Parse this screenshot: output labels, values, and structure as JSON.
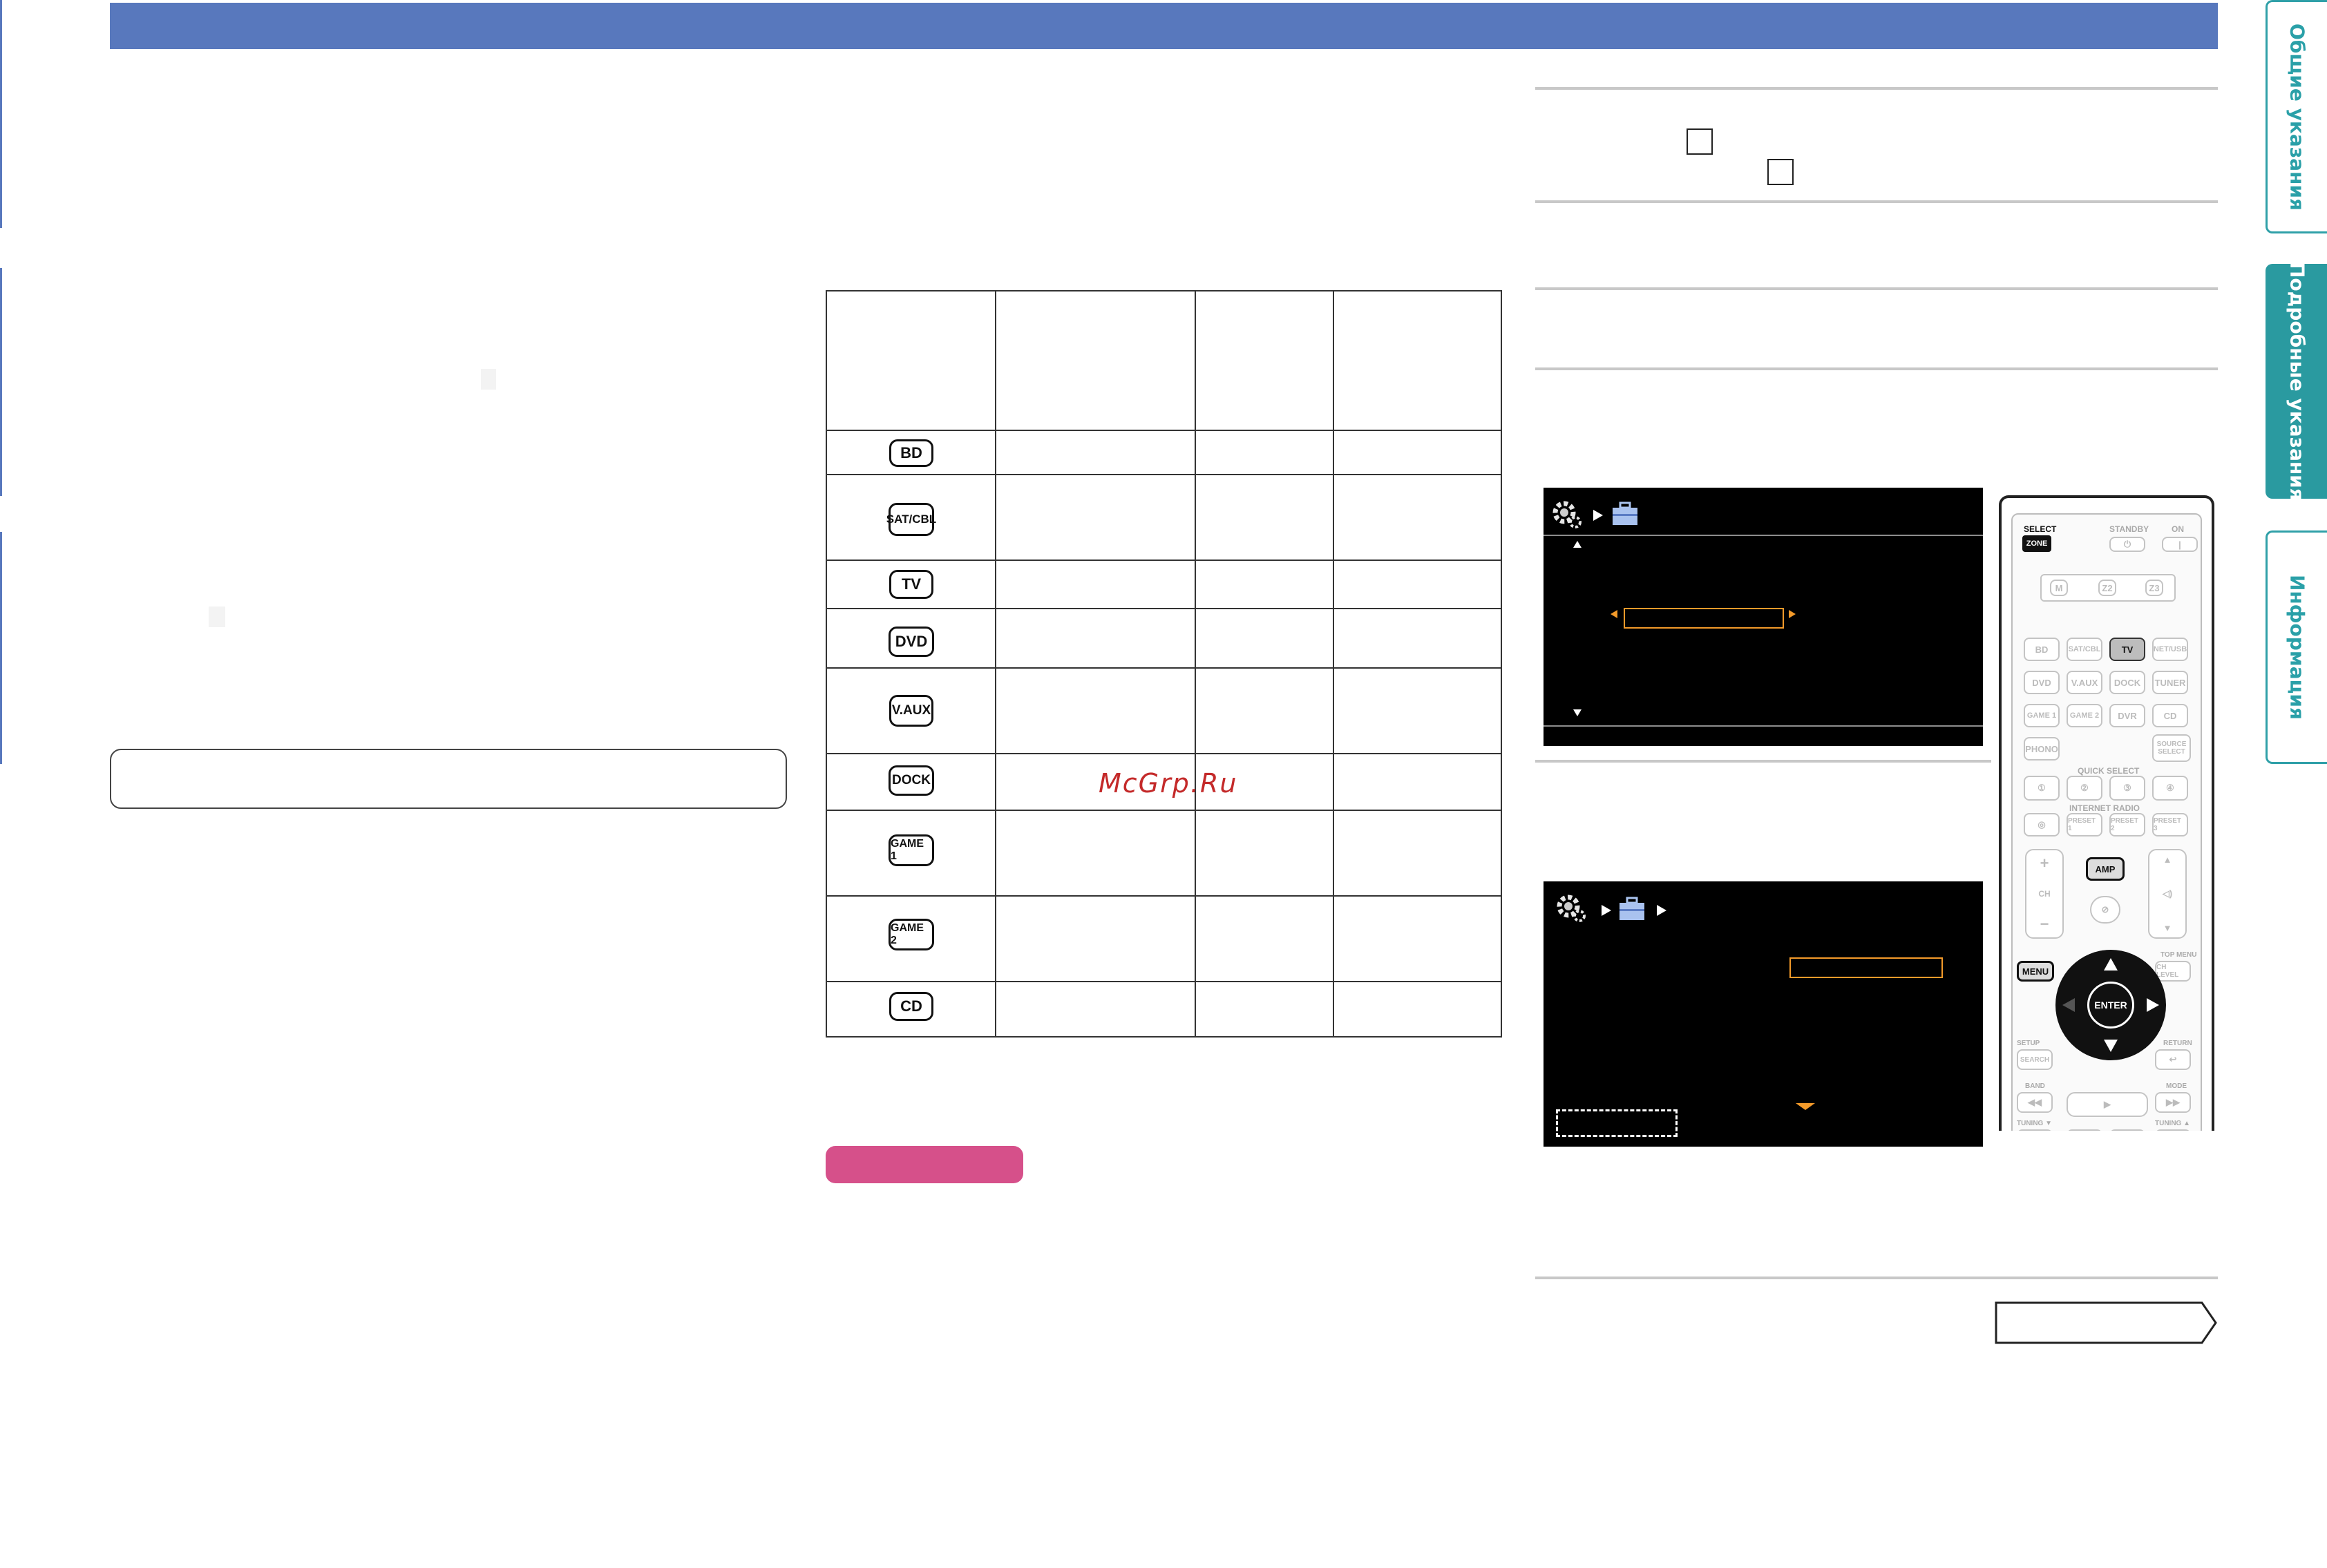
{
  "side_tabs": [
    {
      "label": "Общие указания",
      "active": false
    },
    {
      "label": "Подробные указания",
      "active": true
    },
    {
      "label": "Информация",
      "active": false
    }
  ],
  "input_table": {
    "buttons": [
      "BD",
      "SAT/CBL",
      "TV",
      "DVD",
      "V.AUX",
      "DOCK",
      "GAME 1",
      "GAME 2",
      "CD"
    ]
  },
  "watermark": "McGrp.Ru",
  "remote": {
    "select_label": "SELECT",
    "zone_label": "ZONE",
    "standby_label": "STANDBY",
    "on_label": "ON",
    "zone_buttons": [
      "M",
      "Z2",
      "Z3"
    ],
    "source_rows": [
      [
        "BD",
        "SAT/CBL",
        "TV",
        "NET/USB"
      ],
      [
        "DVD",
        "V.AUX",
        "DOCK",
        "TUNER"
      ],
      [
        "GAME 1",
        "GAME 2",
        "DVR",
        "CD"
      ]
    ],
    "phono_label": "PHONO",
    "source_select_label": "SOURCE SELECT",
    "quick_select_label": "QUICK SELECT",
    "internet_radio_label": "INTERNET RADIO",
    "preset_buttons": [
      "PRESET 1",
      "PRESET 2",
      "PRESET 3"
    ],
    "ch_label": "CH",
    "amp_label": "AMP",
    "top_menu_label": "TOP MENU",
    "ch_level_label": "CH LEVEL",
    "menu_label": "MENU",
    "enter_label": "ENTER",
    "setup_label": "SETUP",
    "search_label": "SEARCH",
    "return_label": "RETURN",
    "band_label": "BAND",
    "mode_label": "MODE",
    "tuning_down_label": "TUNING ▼",
    "tuning_up_label": "TUNING ▲"
  },
  "colors": {
    "header_bar": "#5878bd",
    "tab_accent": "#2a9aa0",
    "pink_label": "#d6508a",
    "osd_highlight": "#f39a2a",
    "watermark": "#c42a2a"
  }
}
